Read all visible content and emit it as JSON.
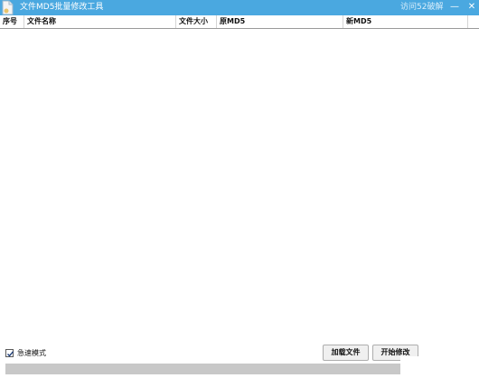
{
  "window": {
    "title": "文件MD5批量修改工具",
    "visit_link": "访问52破解",
    "minimize_glyph": "—",
    "close_glyph": "✕"
  },
  "table": {
    "columns": [
      "序号",
      "文件名称",
      "文件大小",
      "原MD5",
      "新MD5"
    ],
    "rows": []
  },
  "options": {
    "fast_mode_label": "急速模式",
    "fast_mode_checked": true
  },
  "buttons": {
    "load": "加载文件",
    "start": "开始修改"
  },
  "progress": {
    "value": 0
  },
  "colors": {
    "titlebar": "#4aa8e0",
    "progress_track": "#c8c8c8"
  }
}
